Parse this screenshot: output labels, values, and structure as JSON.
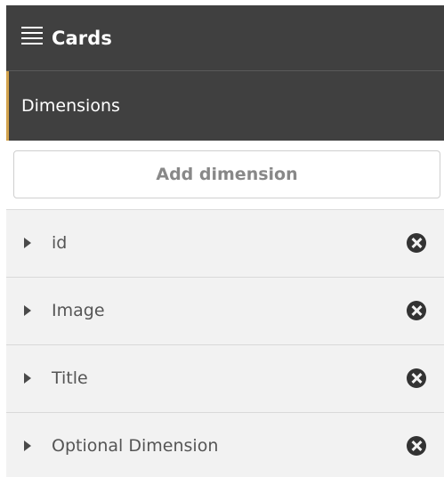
{
  "header": {
    "menu_icon": "hamburger-icon",
    "title": "Cards"
  },
  "section": {
    "title": "Dimensions",
    "accent_color": "#d2a24c"
  },
  "add_dimension": {
    "label": "Add dimension"
  },
  "dimensions": [
    {
      "label": "id",
      "expand_icon": "caret-right-icon",
      "remove_icon": "remove-circle-icon"
    },
    {
      "label": "Image",
      "expand_icon": "caret-right-icon",
      "remove_icon": "remove-circle-icon"
    },
    {
      "label": "Title",
      "expand_icon": "caret-right-icon",
      "remove_icon": "remove-circle-icon"
    },
    {
      "label": "Optional Dimension",
      "expand_icon": "caret-right-icon",
      "remove_icon": "remove-circle-icon"
    }
  ],
  "colors": {
    "header_bg": "#404040",
    "list_bg": "#f2f2f2",
    "text": "#555555"
  }
}
